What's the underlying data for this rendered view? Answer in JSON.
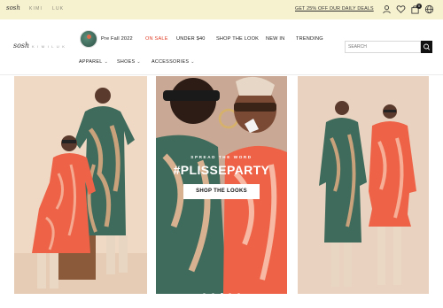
{
  "topbar": {
    "brands": [
      {
        "label": "sosh",
        "active": true
      },
      {
        "label": "KIMI",
        "active": false
      },
      {
        "label": "LUK",
        "active": false
      }
    ],
    "promo_text": "GET 25% OFF OUR DAILY DEALS",
    "icons": [
      "user-icon",
      "heart-icon",
      "bag-icon",
      "globe-icon"
    ],
    "cart_count": "0"
  },
  "header": {
    "logo": "sosh",
    "logo_sub": "K I M I  L U K",
    "featured_label": "Pre Fall 2022",
    "nav": [
      "ON SALE",
      "UNDER $40",
      "SHOP THE LOOK",
      "NEW IN",
      "TRENDING"
    ],
    "subnav": [
      "APPAREL",
      "SHOES",
      "ACCESSORIES"
    ],
    "search_placeholder": "SEARCH"
  },
  "hero": {
    "kicker": "SPREAD THE WORD",
    "title": "#PLISSEPARTY",
    "button_label": "SHOP THE LOOKS",
    "slide_count": 5,
    "active_slide": 2
  },
  "colors": {
    "promo_bar": "#f6f1cf",
    "sale": "#e0402a",
    "dress_coral": "#ee6347",
    "dress_green": "#3f6b5c",
    "backdrop": "#efd9c4"
  }
}
